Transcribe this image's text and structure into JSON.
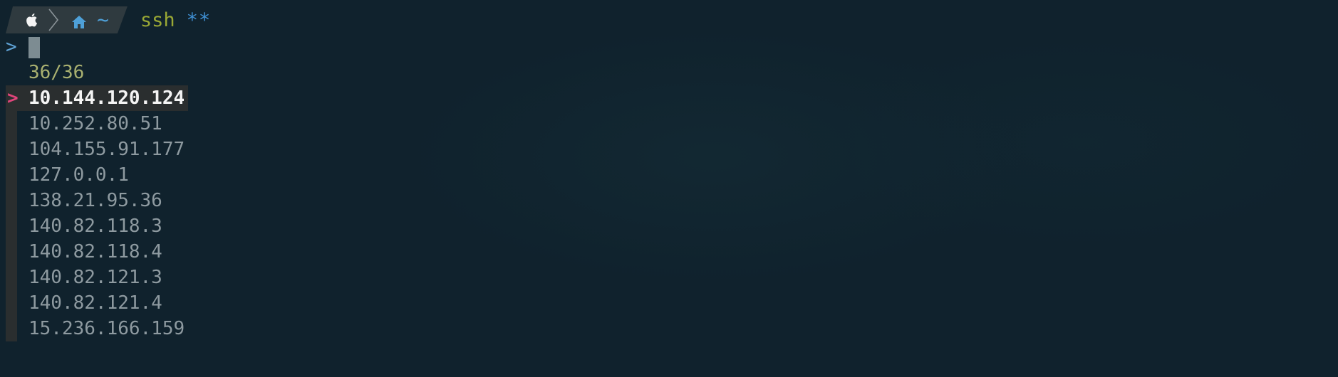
{
  "prompt": {
    "apple_icon": "apple-logo-icon",
    "separator_icon": "chevron-right-icon",
    "home_icon": "home-icon",
    "path": "~",
    "command": "ssh",
    "argument": "**"
  },
  "finder": {
    "query_marker": ">",
    "query": "",
    "count": "36/36",
    "pointer": ">",
    "selected_index": 0,
    "items": [
      "10.144.120.124",
      "10.252.80.51",
      "104.155.91.177",
      "127.0.0.1",
      "138.21.95.36",
      "140.82.118.3",
      "140.82.118.4",
      "140.82.121.3",
      "140.82.121.4",
      "15.236.166.159"
    ]
  },
  "colors": {
    "background": "#10222d",
    "prompt_segment": "#2f3a3f",
    "path": "#4ea0d8",
    "command": "#9aa835",
    "argument": "#3f8fd2",
    "count": "#a9b070",
    "pointer": "#e0457b",
    "item": "#8e9aa0",
    "selected_item": "#f4f4f4",
    "selection_bg": "#2a2e2f"
  }
}
